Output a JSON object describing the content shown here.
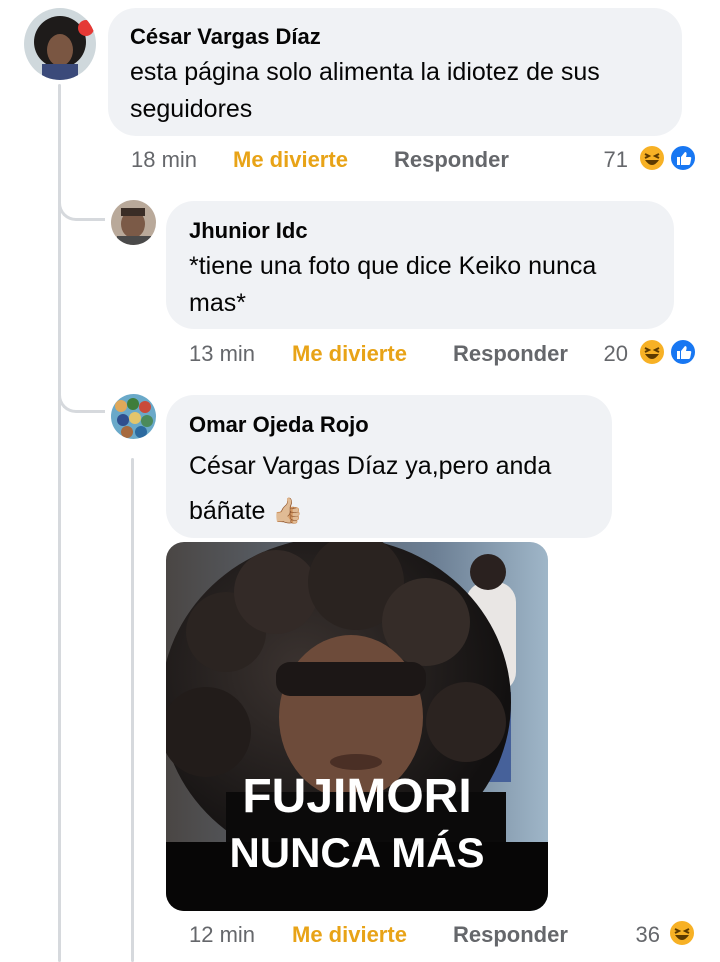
{
  "comments": [
    {
      "author": "César Vargas Díaz",
      "text_line1": "esta página solo alimenta la idiotez de sus",
      "text_line2": "seguidores",
      "time": "18 min",
      "laugh_label": "Me divierte",
      "reply_label": "Responder",
      "reaction_count": "71",
      "reactions": [
        "haha-icon",
        "like-icon"
      ]
    },
    {
      "author": "Jhunior Idc",
      "text_line1": "*tiene una foto que dice Keiko nunca",
      "text_line2": "mas*",
      "time": "13 min",
      "laugh_label": "Me divierte",
      "reply_label": "Responder",
      "reaction_count": "20",
      "reactions": [
        "haha-icon",
        "like-icon"
      ]
    },
    {
      "author": "Omar Ojeda Rojo",
      "text_line1": "César Vargas Díaz ya,pero anda",
      "text_line2": "báñate",
      "emoji": "👍🏼",
      "image_caption_line1": "FUJIMORI",
      "image_caption_line2": "NUNCA MÁS",
      "time": "12 min",
      "laugh_label": "Me divierte",
      "reply_label": "Responder",
      "reaction_count": "36",
      "reactions": [
        "haha-icon"
      ]
    }
  ],
  "colors": {
    "bubble": "#f0f2f5",
    "laugh": "#e8a317",
    "meta": "#65676b",
    "like": "#1877f2",
    "haha": "#f7b125"
  }
}
